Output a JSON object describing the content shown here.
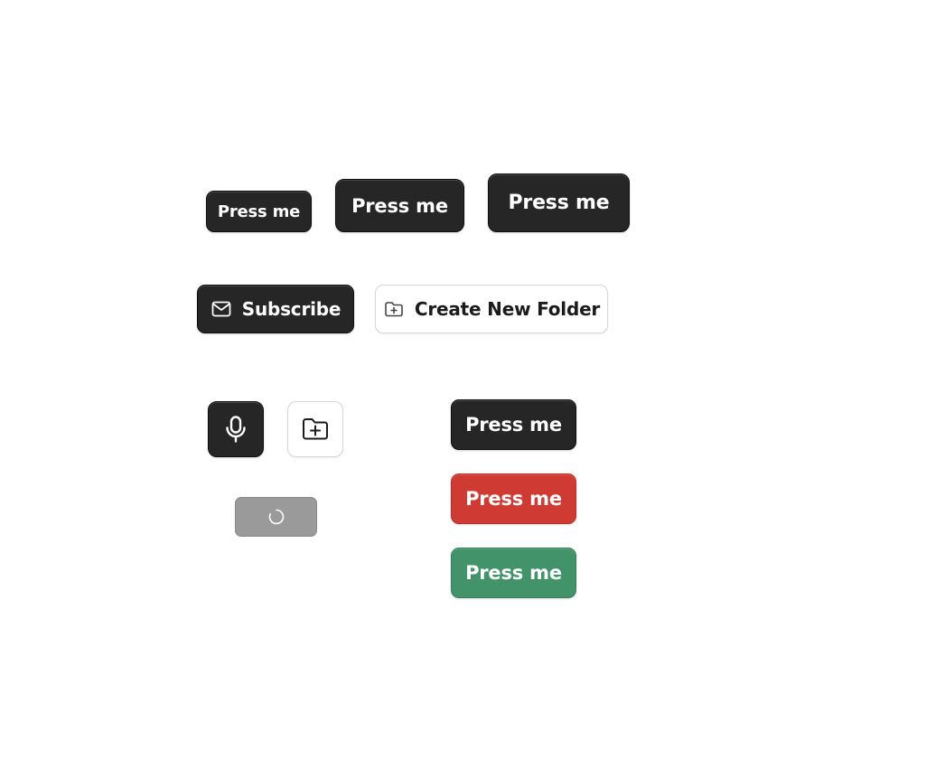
{
  "size_row": {
    "small_label": "Press me",
    "medium_label": "Press me",
    "large_label": "Press me"
  },
  "icon_text_row": {
    "subscribe_label": "Subscribe",
    "subscribe_icon": "mail-icon",
    "create_folder_label": "Create New Folder",
    "create_folder_icon": "folder-plus-icon"
  },
  "icon_buttons": {
    "mic_icon": "microphone-icon",
    "folder_icon": "folder-plus-icon"
  },
  "loading_button": {
    "icon": "spinner-icon",
    "state": "loading"
  },
  "variant_column": {
    "default_label": "Press me",
    "danger_label": "Press me",
    "success_label": "Press me"
  },
  "colors": {
    "dark": "#262626",
    "danger": "#cf3a33",
    "success": "#42936a",
    "disabled": "#9a9a9a",
    "outline_border": "#d7d7d7"
  }
}
